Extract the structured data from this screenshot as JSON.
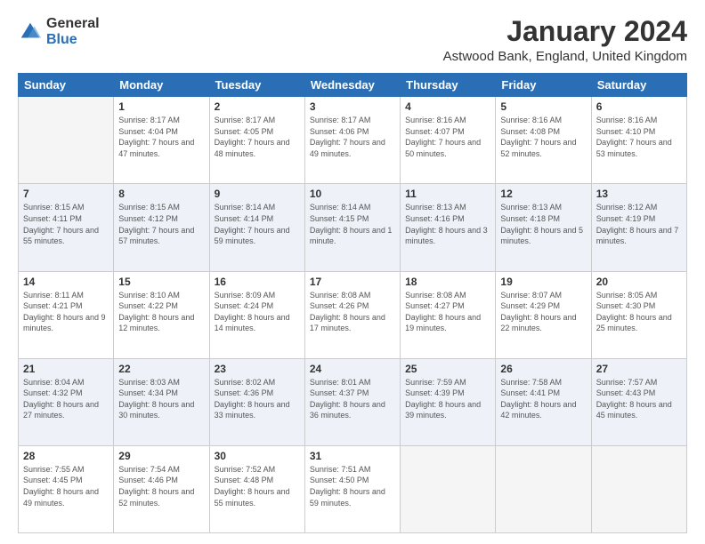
{
  "logo": {
    "general": "General",
    "blue": "Blue"
  },
  "header": {
    "title": "January 2024",
    "subtitle": "Astwood Bank, England, United Kingdom"
  },
  "days_of_week": [
    "Sunday",
    "Monday",
    "Tuesday",
    "Wednesday",
    "Thursday",
    "Friday",
    "Saturday"
  ],
  "weeks": [
    [
      {
        "day": "",
        "sunrise": "",
        "sunset": "",
        "daylight": ""
      },
      {
        "day": "1",
        "sunrise": "Sunrise: 8:17 AM",
        "sunset": "Sunset: 4:04 PM",
        "daylight": "Daylight: 7 hours and 47 minutes."
      },
      {
        "day": "2",
        "sunrise": "Sunrise: 8:17 AM",
        "sunset": "Sunset: 4:05 PM",
        "daylight": "Daylight: 7 hours and 48 minutes."
      },
      {
        "day": "3",
        "sunrise": "Sunrise: 8:17 AM",
        "sunset": "Sunset: 4:06 PM",
        "daylight": "Daylight: 7 hours and 49 minutes."
      },
      {
        "day": "4",
        "sunrise": "Sunrise: 8:16 AM",
        "sunset": "Sunset: 4:07 PM",
        "daylight": "Daylight: 7 hours and 50 minutes."
      },
      {
        "day": "5",
        "sunrise": "Sunrise: 8:16 AM",
        "sunset": "Sunset: 4:08 PM",
        "daylight": "Daylight: 7 hours and 52 minutes."
      },
      {
        "day": "6",
        "sunrise": "Sunrise: 8:16 AM",
        "sunset": "Sunset: 4:10 PM",
        "daylight": "Daylight: 7 hours and 53 minutes."
      }
    ],
    [
      {
        "day": "7",
        "sunrise": "Sunrise: 8:15 AM",
        "sunset": "Sunset: 4:11 PM",
        "daylight": "Daylight: 7 hours and 55 minutes."
      },
      {
        "day": "8",
        "sunrise": "Sunrise: 8:15 AM",
        "sunset": "Sunset: 4:12 PM",
        "daylight": "Daylight: 7 hours and 57 minutes."
      },
      {
        "day": "9",
        "sunrise": "Sunrise: 8:14 AM",
        "sunset": "Sunset: 4:14 PM",
        "daylight": "Daylight: 7 hours and 59 minutes."
      },
      {
        "day": "10",
        "sunrise": "Sunrise: 8:14 AM",
        "sunset": "Sunset: 4:15 PM",
        "daylight": "Daylight: 8 hours and 1 minute."
      },
      {
        "day": "11",
        "sunrise": "Sunrise: 8:13 AM",
        "sunset": "Sunset: 4:16 PM",
        "daylight": "Daylight: 8 hours and 3 minutes."
      },
      {
        "day": "12",
        "sunrise": "Sunrise: 8:13 AM",
        "sunset": "Sunset: 4:18 PM",
        "daylight": "Daylight: 8 hours and 5 minutes."
      },
      {
        "day": "13",
        "sunrise": "Sunrise: 8:12 AM",
        "sunset": "Sunset: 4:19 PM",
        "daylight": "Daylight: 8 hours and 7 minutes."
      }
    ],
    [
      {
        "day": "14",
        "sunrise": "Sunrise: 8:11 AM",
        "sunset": "Sunset: 4:21 PM",
        "daylight": "Daylight: 8 hours and 9 minutes."
      },
      {
        "day": "15",
        "sunrise": "Sunrise: 8:10 AM",
        "sunset": "Sunset: 4:22 PM",
        "daylight": "Daylight: 8 hours and 12 minutes."
      },
      {
        "day": "16",
        "sunrise": "Sunrise: 8:09 AM",
        "sunset": "Sunset: 4:24 PM",
        "daylight": "Daylight: 8 hours and 14 minutes."
      },
      {
        "day": "17",
        "sunrise": "Sunrise: 8:08 AM",
        "sunset": "Sunset: 4:26 PM",
        "daylight": "Daylight: 8 hours and 17 minutes."
      },
      {
        "day": "18",
        "sunrise": "Sunrise: 8:08 AM",
        "sunset": "Sunset: 4:27 PM",
        "daylight": "Daylight: 8 hours and 19 minutes."
      },
      {
        "day": "19",
        "sunrise": "Sunrise: 8:07 AM",
        "sunset": "Sunset: 4:29 PM",
        "daylight": "Daylight: 8 hours and 22 minutes."
      },
      {
        "day": "20",
        "sunrise": "Sunrise: 8:05 AM",
        "sunset": "Sunset: 4:30 PM",
        "daylight": "Daylight: 8 hours and 25 minutes."
      }
    ],
    [
      {
        "day": "21",
        "sunrise": "Sunrise: 8:04 AM",
        "sunset": "Sunset: 4:32 PM",
        "daylight": "Daylight: 8 hours and 27 minutes."
      },
      {
        "day": "22",
        "sunrise": "Sunrise: 8:03 AM",
        "sunset": "Sunset: 4:34 PM",
        "daylight": "Daylight: 8 hours and 30 minutes."
      },
      {
        "day": "23",
        "sunrise": "Sunrise: 8:02 AM",
        "sunset": "Sunset: 4:36 PM",
        "daylight": "Daylight: 8 hours and 33 minutes."
      },
      {
        "day": "24",
        "sunrise": "Sunrise: 8:01 AM",
        "sunset": "Sunset: 4:37 PM",
        "daylight": "Daylight: 8 hours and 36 minutes."
      },
      {
        "day": "25",
        "sunrise": "Sunrise: 7:59 AM",
        "sunset": "Sunset: 4:39 PM",
        "daylight": "Daylight: 8 hours and 39 minutes."
      },
      {
        "day": "26",
        "sunrise": "Sunrise: 7:58 AM",
        "sunset": "Sunset: 4:41 PM",
        "daylight": "Daylight: 8 hours and 42 minutes."
      },
      {
        "day": "27",
        "sunrise": "Sunrise: 7:57 AM",
        "sunset": "Sunset: 4:43 PM",
        "daylight": "Daylight: 8 hours and 45 minutes."
      }
    ],
    [
      {
        "day": "28",
        "sunrise": "Sunrise: 7:55 AM",
        "sunset": "Sunset: 4:45 PM",
        "daylight": "Daylight: 8 hours and 49 minutes."
      },
      {
        "day": "29",
        "sunrise": "Sunrise: 7:54 AM",
        "sunset": "Sunset: 4:46 PM",
        "daylight": "Daylight: 8 hours and 52 minutes."
      },
      {
        "day": "30",
        "sunrise": "Sunrise: 7:52 AM",
        "sunset": "Sunset: 4:48 PM",
        "daylight": "Daylight: 8 hours and 55 minutes."
      },
      {
        "day": "31",
        "sunrise": "Sunrise: 7:51 AM",
        "sunset": "Sunset: 4:50 PM",
        "daylight": "Daylight: 8 hours and 59 minutes."
      },
      {
        "day": "",
        "sunrise": "",
        "sunset": "",
        "daylight": ""
      },
      {
        "day": "",
        "sunrise": "",
        "sunset": "",
        "daylight": ""
      },
      {
        "day": "",
        "sunrise": "",
        "sunset": "",
        "daylight": ""
      }
    ]
  ]
}
